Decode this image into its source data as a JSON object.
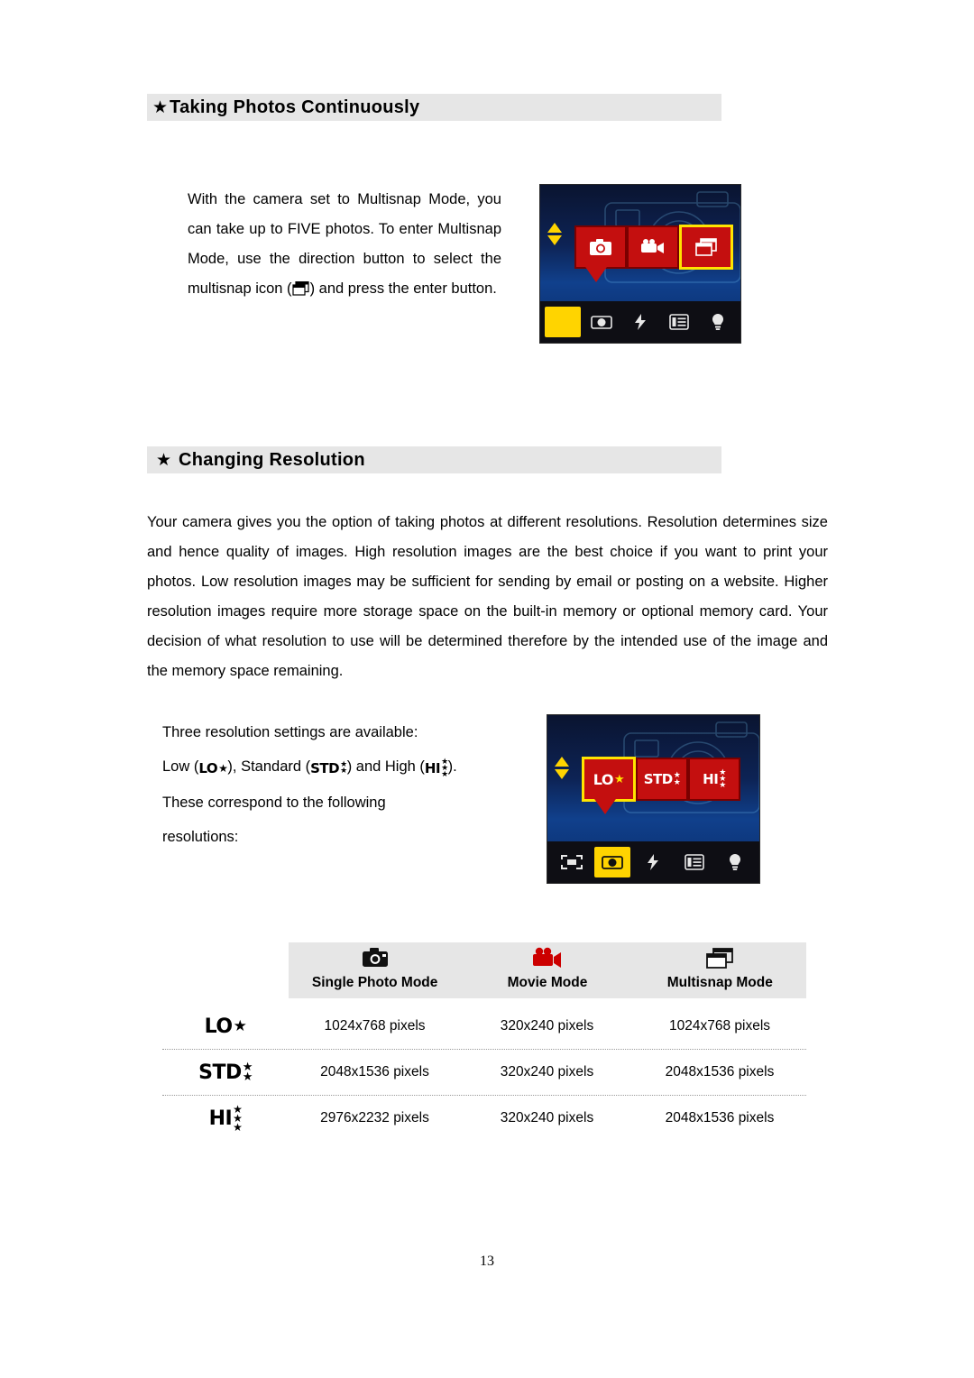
{
  "page": {
    "number": "13"
  },
  "section1": {
    "star": "★",
    "title": "Taking Photos Continuously",
    "body": "With the camera set to Multisnap Mode, you can take up to FIVE photos. To enter Multisnap Mode, use the direction button to select the multisnap icon (   ) and press the enter button.",
    "body_part1": "With the camera set to Multisnap Mode, you can take up to FIVE photos. To enter Multisnap Mode, use the direction button to select the multisnap icon (",
    "body_part2": ") and press the enter button.",
    "lcd": {
      "icons": [
        "single-photo-icon",
        "movie-icon",
        "multisnap-icon"
      ],
      "bottom_icons": [
        "frame-icon",
        "photo-mode-icon",
        "flash-icon",
        "menu-icon",
        "bulb-icon"
      ],
      "selected_bottom": "frame-icon"
    }
  },
  "section2": {
    "star": "★",
    "title": "Changing Resolution",
    "body": "Your camera gives you the option of taking photos at different resolutions. Resolution determines size and hence quality of images. High resolution images are the best choice if you want to print your photos. Low resolution images may be sufficient for sending by email or posting on a website. Higher resolution images require more storage space on the built-in memory or optional memory card. Your decision of what resolution to use will be determined therefore by the intended use of the image and the memory space remaining.",
    "intro_line1": "Three resolution settings are available:",
    "intro_low": "Low (",
    "intro_mid": "), Standard (",
    "intro_high": ") and High (",
    "intro_close": ").",
    "intro_line3": "These correspond to the following",
    "intro_line4": "resolutions:",
    "lcd": {
      "modes": [
        "LO",
        "STD",
        "HI"
      ],
      "selected_mode": "LO",
      "bottom_icons": [
        "frame-icon",
        "photo-mode-icon",
        "flash-icon",
        "menu-icon",
        "bulb-icon"
      ],
      "selected_bottom": "photo-mode-icon"
    }
  },
  "table": {
    "icon_headers": [
      "single-photo-icon",
      "movie-icon",
      "multisnap-icon"
    ],
    "headers": [
      "",
      "Single Photo Mode",
      "Movie Mode",
      "Multisnap Mode"
    ],
    "rows": [
      {
        "label": "LO",
        "label_stars": 1,
        "values": [
          "1024x768 pixels",
          "320x240 pixels",
          "1024x768 pixels"
        ]
      },
      {
        "label": "STD",
        "label_stars": 2,
        "values": [
          "2048x1536 pixels",
          "320x240 pixels",
          "2048x1536 pixels"
        ]
      },
      {
        "label": "HI",
        "label_stars": 3,
        "values": [
          "2976x2232 pixels",
          "320x240 pixels",
          "2048x1536 pixels"
        ]
      }
    ]
  },
  "glyphs": {
    "star": "★",
    "lo": "LO",
    "std": "STD",
    "hi": "HI"
  },
  "colors": {
    "band": "#e6e6e6",
    "lcd_red": "#c40f0f",
    "lcd_yellow": "#ffd400",
    "lcd_blue": "#10408c"
  }
}
